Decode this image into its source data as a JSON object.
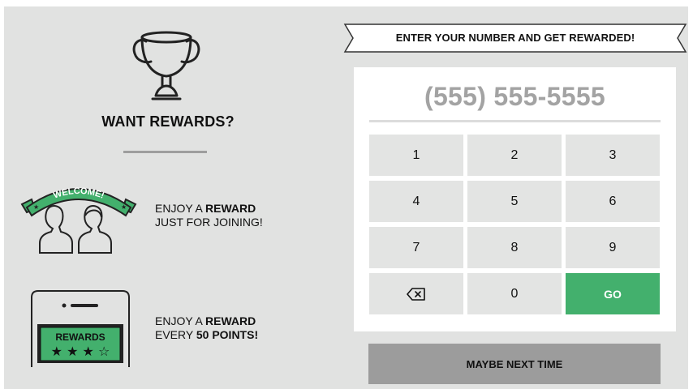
{
  "left_panel": {
    "title": "WANT REWARDS?",
    "welcome_banner_text": "WELCOME!",
    "feature1_prefix": "ENJOY A ",
    "feature1_bold": "REWARD",
    "feature1_line2": "JUST FOR JOINING!",
    "rewards_card_text": "REWARDS",
    "feature2_prefix": "ENJOY A ",
    "feature2_bold": "REWARD",
    "feature2_line2_prefix": "EVERY ",
    "feature2_line2_bold": "50 POINTS!",
    "icons": [
      "trophy-icon",
      "welcome-members-icon",
      "phone-rewards-icon"
    ]
  },
  "banner": {
    "text": "ENTER YOUR NUMBER AND GET REWARDED!"
  },
  "keypad": {
    "phone_placeholder": "(555) 555-5555",
    "keys": [
      "1",
      "2",
      "3",
      "4",
      "5",
      "6",
      "7",
      "8",
      "9"
    ],
    "backspace_icon": "backspace-icon",
    "zero": "0",
    "go": "GO"
  },
  "maybe_next_time": "MAYBE NEXT TIME",
  "colors": {
    "background": "#e1e2e1",
    "accent_green": "#43b06d",
    "key_bg": "#e3e4e3",
    "secondary_button": "#9c9c9c",
    "placeholder_text": "#a3a3a3"
  }
}
